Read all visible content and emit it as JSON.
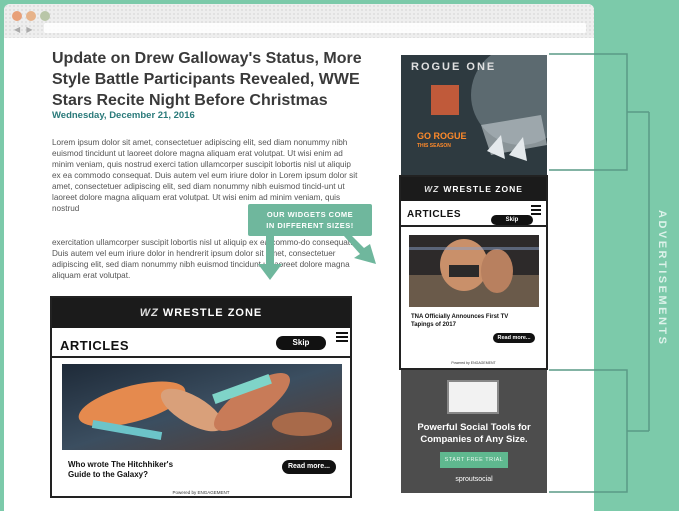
{
  "article": {
    "title": "Update on Drew Galloway's Status, More Style Battle Participants Revealed, WWE Stars Recite Night Before Christmas",
    "date": "Wednesday, December 21, 2016",
    "paragraph1": "Lorem ipsum dolor sit amet, consectetuer adipiscing elit, sed diam nonummy nibh euismod tincidunt ut laoreet dolore magna aliquam erat volutpat. Ut wisi enim ad minim veniam, quis nostrud exerci tation ullamcorper suscipit lobortis nisl ut aliquip ex ea commodo consequat. Duis autem vel eum iriure dolor in Lorem ipsum dolor sit amet, consectetuer adipiscing elit, sed diam nonummy nibh euismod tincid-unt ut laoreet dolore magna aliquam erat volutpat. Ut wisi enim ad minim veniam, quis nostrud",
    "paragraph2": "exercitation ullamcorper suscipit lobortis nisl ut aliquip ex ea commo-do consequat. Duis autem vel eum iriure dolor in hendrerit ipsum dolor sit amet, consectetuer adipiscing elit, sed diam nonummy nibh euismod tincidunt ut laoreet dolore magna aliquam erat volutpat."
  },
  "callout": {
    "line1": "OUR WIDGETS COME",
    "line2": "IN DIFFERENT SIZES!"
  },
  "widget_large": {
    "brand": "WRESTLE ZONE",
    "section": "ARTICLES",
    "skip": "Skip",
    "question_line1": "Who wrote The Hitchhiker's",
    "question_line2": "Guide to the Galaxy?",
    "read_more": "Read more...",
    "powered": "Powered by ENGAGEMENT"
  },
  "widget_small": {
    "brand": "WRESTLE ZONE",
    "section": "ARTICLES",
    "skip": "Skip",
    "headline_line1": "TNA Officially Announces First TV",
    "headline_line2": "Tapings of 2017",
    "read_more": "Read more...",
    "powered": "Powered by ENGAGEMENT"
  },
  "ad_top": {
    "title": "ROGUE ONE",
    "tagline_line1": "GO ROGUE",
    "tagline_line2": "THIS SEASON"
  },
  "ad_bottom": {
    "headline_line1": "Powerful Social Tools for",
    "headline_line2": "Companies of Any Size.",
    "cta": "START FREE TRIAL",
    "brand": "sproutsocial"
  },
  "side_label": "ADVERTISEMENTS",
  "colors": {
    "accent": "#7ccaaa",
    "dark": "#1b1b1b",
    "ad_orange": "#ff8a2a",
    "sprout_green": "#5fb88f"
  }
}
